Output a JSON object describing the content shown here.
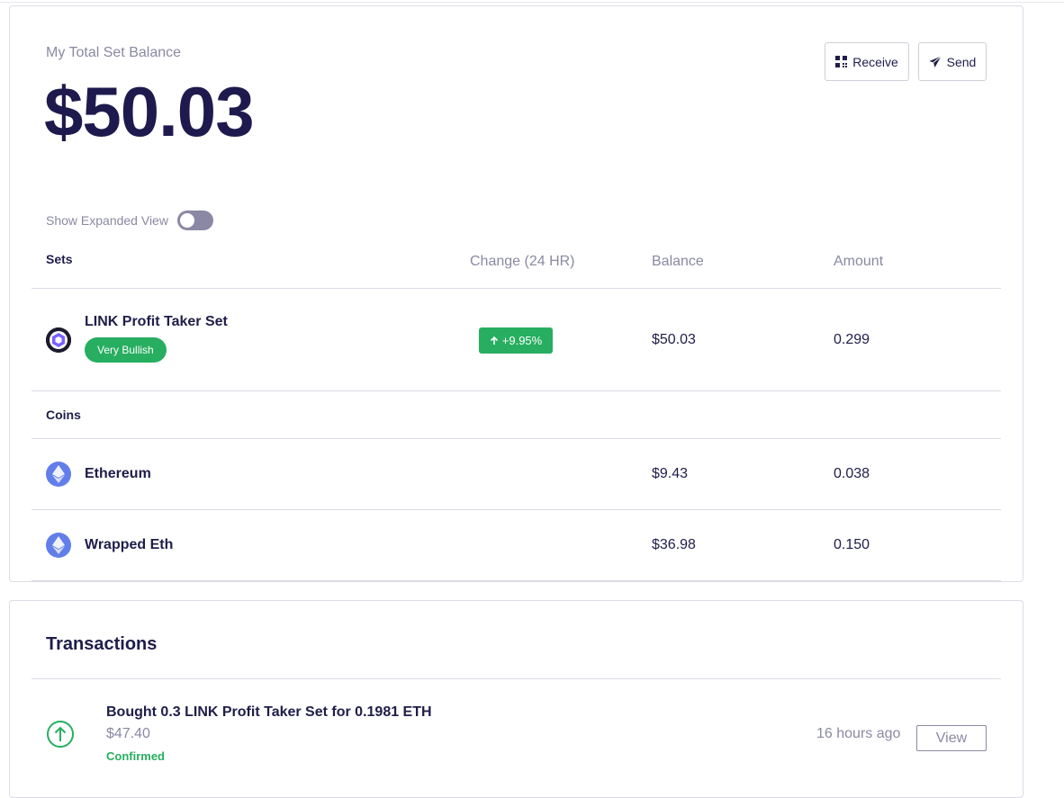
{
  "balance_card": {
    "title": "My Total Set Balance",
    "amount": "$50.03",
    "buttons": {
      "receive": "Receive",
      "send": "Send"
    },
    "toggle": {
      "label": "Show Expanded View",
      "on": false
    },
    "columns": {
      "sets": "Sets",
      "change": "Change (24 HR)",
      "balance": "Balance",
      "amount": "Amount"
    },
    "sets": [
      {
        "name": "LINK Profit Taker Set",
        "tag": "Very Bullish",
        "change": "+9.95%",
        "balance": "$50.03",
        "amount": "0.299",
        "icon": "link-set-icon"
      }
    ],
    "coins_label": "Coins",
    "coins": [
      {
        "name": "Ethereum",
        "balance": "$9.43",
        "amount": "0.038",
        "icon": "ethereum-icon"
      },
      {
        "name": "Wrapped Eth",
        "balance": "$36.98",
        "amount": "0.150",
        "icon": "ethereum-icon"
      }
    ]
  },
  "transactions": {
    "title": "Transactions",
    "items": [
      {
        "description": "Bought 0.3 LINK Profit Taker Set for 0.1981 ETH",
        "amount": "$47.40",
        "status": "Confirmed",
        "time": "16 hours ago",
        "action": "View",
        "icon": "arrow-up-circle-icon"
      }
    ]
  },
  "colors": {
    "primary_text": "#1f1a4d",
    "muted": "#8a89a3",
    "positive": "#27ae60",
    "eth": "#627eea"
  }
}
